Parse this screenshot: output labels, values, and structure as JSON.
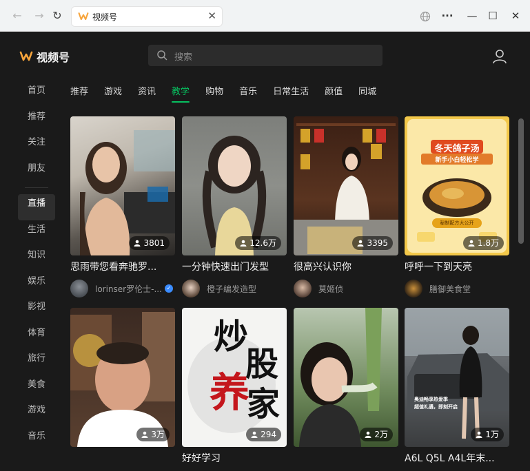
{
  "browser": {
    "tab_title": "视频号",
    "tab_close": "✕",
    "back": "←",
    "forward": "→",
    "refresh": "↻",
    "menu": "···",
    "minimize": "—",
    "maximize": "☐",
    "close": "✕"
  },
  "header": {
    "logo_text": "视频号",
    "search_placeholder": "搜索"
  },
  "sidebar": {
    "items": [
      {
        "label": "首页"
      },
      {
        "label": "推荐"
      },
      {
        "label": "关注"
      },
      {
        "label": "朋友"
      },
      {
        "label": "直播"
      },
      {
        "label": "生活"
      },
      {
        "label": "知识"
      },
      {
        "label": "娱乐"
      },
      {
        "label": "影视"
      },
      {
        "label": "体育"
      },
      {
        "label": "旅行"
      },
      {
        "label": "美食"
      },
      {
        "label": "游戏"
      },
      {
        "label": "音乐"
      }
    ],
    "active_index": 4
  },
  "category_tabs": {
    "items": [
      {
        "label": "推荐"
      },
      {
        "label": "游戏"
      },
      {
        "label": "资讯"
      },
      {
        "label": "教学"
      },
      {
        "label": "购物"
      },
      {
        "label": "音乐"
      },
      {
        "label": "日常生活"
      },
      {
        "label": "颜值"
      },
      {
        "label": "同城"
      }
    ],
    "active_index": 3,
    "accent_color": "#07c160"
  },
  "cards": [
    {
      "title": "思雨带您看奔驰罗...",
      "viewers": "3801",
      "author": "lorinser罗伦士-...",
      "verified": true
    },
    {
      "title": "一分钟快速出门发型",
      "viewers": "12.6万",
      "author": "橙子编发造型",
      "verified": false
    },
    {
      "title": "很高兴认识你",
      "viewers": "3395",
      "author": "莫姬侦",
      "verified": false
    },
    {
      "title": "呼呼一下到天亮",
      "viewers": "1.8万",
      "author": "膳御美食堂",
      "verified": false
    },
    {
      "title": "",
      "viewers": "3万",
      "author": "",
      "verified": false
    },
    {
      "title": "好好学习",
      "viewers": "294",
      "author": "",
      "verified": false
    },
    {
      "title": "",
      "viewers": "2万",
      "author": "",
      "verified": false
    },
    {
      "title": "A6L Q5L A4L年末...",
      "viewers": "1万",
      "author": "",
      "verified": false
    }
  ],
  "thumb_texts": {
    "soup_title": "冬天鸽子汤",
    "soup_sub": "新手小白轻松学",
    "soup_badge": "秘制配方大公开",
    "stock_line1": "炒",
    "stock_line2": "股",
    "stock_line3": "养",
    "stock_line4": "家",
    "car_line1": "奥迪畅享热爱季",
    "car_line2": "超值礼遇，即刻开启"
  }
}
